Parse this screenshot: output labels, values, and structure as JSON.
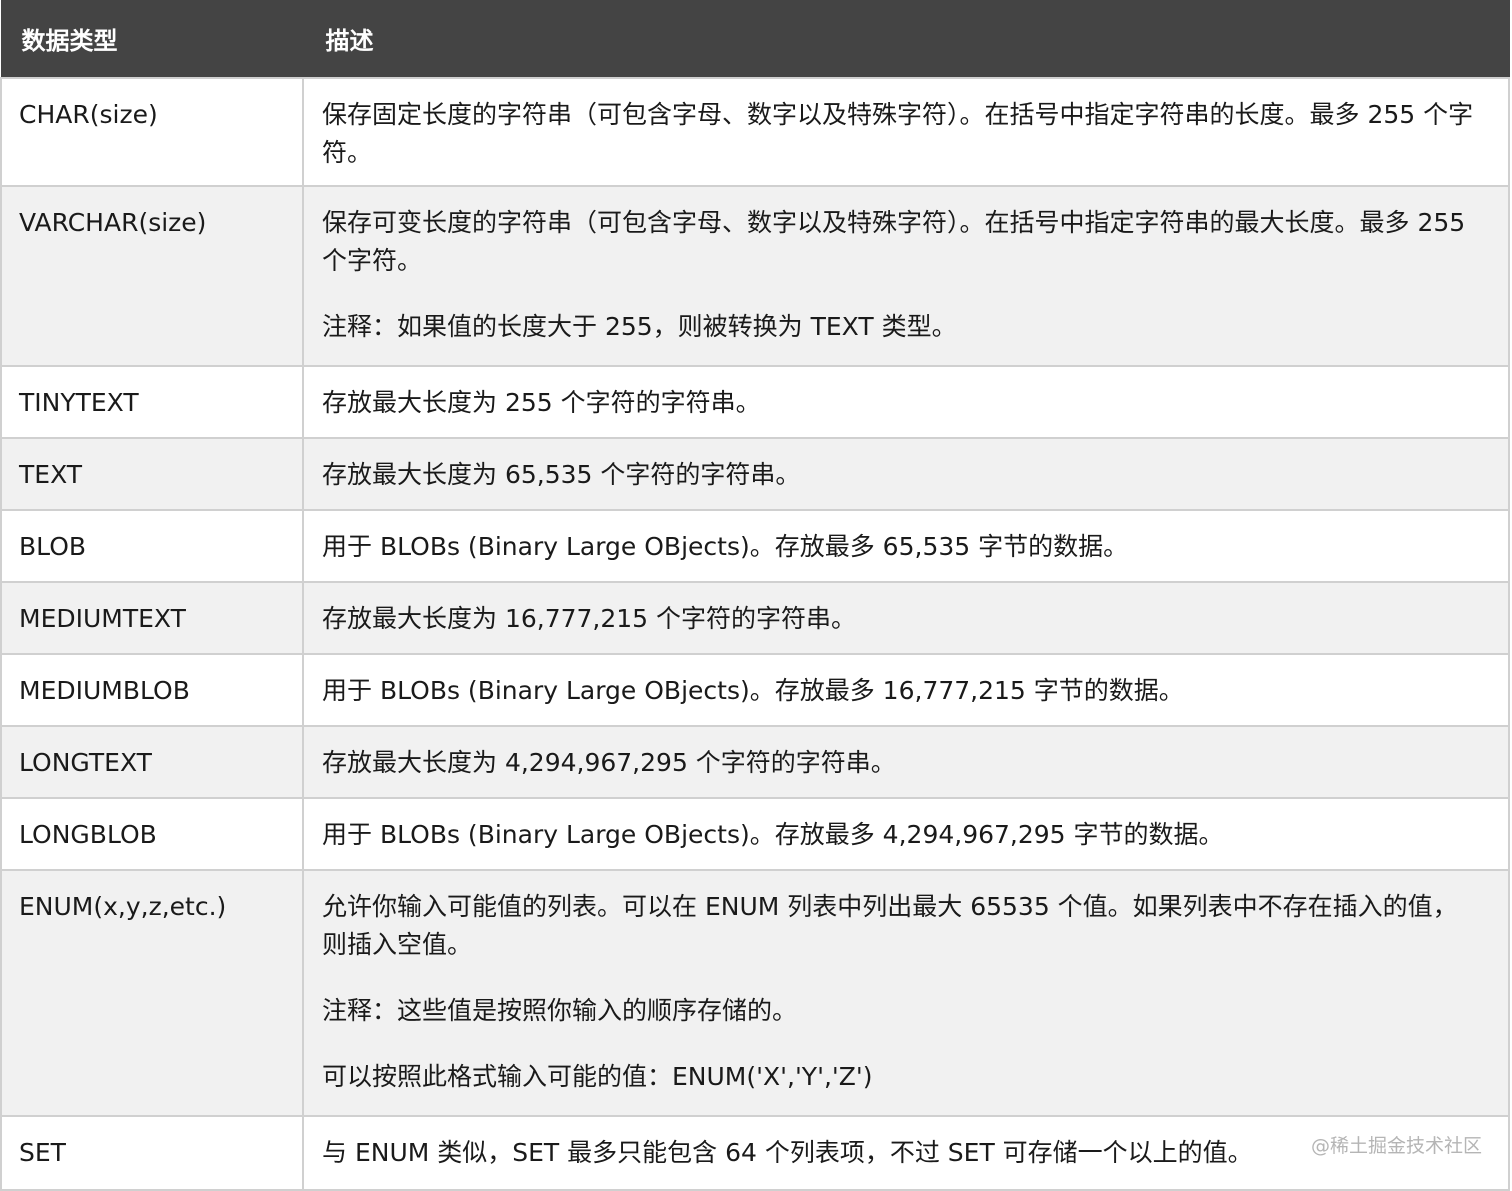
{
  "header": {
    "col_type": "数据类型",
    "col_desc": "描述"
  },
  "rows": [
    {
      "type": "CHAR(size)",
      "desc": [
        "保存固定长度的字符串（可包含字母、数字以及特殊字符）。在括号中指定字符串的长度。最多 255 个字符。"
      ]
    },
    {
      "type": "VARCHAR(size)",
      "desc": [
        "保存可变长度的字符串（可包含字母、数字以及特殊字符）。在括号中指定字符串的最大长度。最多 255 个字符。",
        "注释：如果值的长度大于 255，则被转换为 TEXT 类型。"
      ]
    },
    {
      "type": "TINYTEXT",
      "desc": [
        "存放最大长度为 255 个字符的字符串。"
      ]
    },
    {
      "type": "TEXT",
      "desc": [
        "存放最大长度为 65,535 个字符的字符串。"
      ]
    },
    {
      "type": "BLOB",
      "desc": [
        "用于 BLOBs (Binary Large OBjects)。存放最多 65,535 字节的数据。"
      ]
    },
    {
      "type": "MEDIUMTEXT",
      "desc": [
        "存放最大长度为 16,777,215 个字符的字符串。"
      ]
    },
    {
      "type": "MEDIUMBLOB",
      "desc": [
        "用于 BLOBs (Binary Large OBjects)。存放最多 16,777,215 字节的数据。"
      ]
    },
    {
      "type": "LONGTEXT",
      "desc": [
        "存放最大长度为 4,294,967,295 个字符的字符串。"
      ]
    },
    {
      "type": "LONGBLOB",
      "desc": [
        "用于 BLOBs (Binary Large OBjects)。存放最多 4,294,967,295 字节的数据。"
      ]
    },
    {
      "type": "ENUM(x,y,z,etc.)",
      "desc": [
        "允许你输入可能值的列表。可以在 ENUM 列表中列出最大 65535 个值。如果列表中不存在插入的值，则插入空值。",
        "注释：这些值是按照你输入的顺序存储的。",
        "可以按照此格式输入可能的值：ENUM('X','Y','Z')"
      ]
    },
    {
      "type": "SET",
      "desc": [
        "与 ENUM 类似，SET 最多只能包含 64 个列表项，不过 SET 可存储一个以上的值。"
      ]
    }
  ],
  "watermark": "@稀土掘金技术社区"
}
